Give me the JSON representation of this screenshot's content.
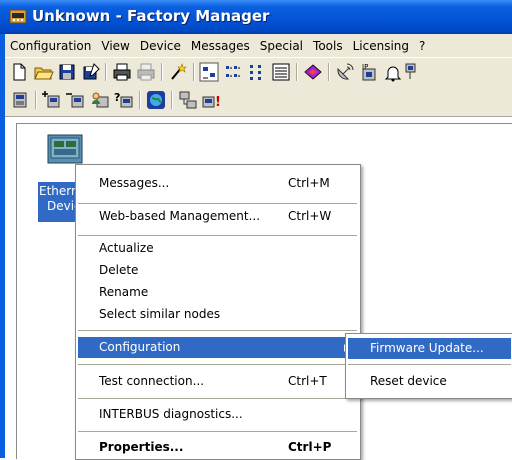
{
  "window": {
    "title": "Unknown - Factory Manager"
  },
  "menubar": [
    "Configuration",
    "View",
    "Device",
    "Messages",
    "Special",
    "Tools",
    "Licensing",
    "?"
  ],
  "toolbar1_icons": [
    "new-icon",
    "open-icon",
    "save-icon",
    "save-as-icon",
    "print-icon",
    "print-preview-icon",
    "wizard-icon",
    "large-icons-icon",
    "small-icons-icon",
    "list-icon",
    "details-icon",
    "book-icon",
    "satellite-icon",
    "ip-icon",
    "bell-icon",
    "network-icon"
  ],
  "toolbar2_icons": [
    "device-list-icon",
    "add-device-icon",
    "remove-device-icon",
    "person-icon",
    "help-device-icon",
    "globe-icon",
    "network-config-icon",
    "alert-device-icon"
  ],
  "node": {
    "label_line1": "Ethern",
    "label_line2": "Devic"
  },
  "context_menu": {
    "items": [
      {
        "label": "Messages...",
        "shortcut": "Ctrl+M"
      },
      {
        "label": "Web-based Management...",
        "shortcut": "Ctrl+W"
      },
      {
        "label": "Actualize"
      },
      {
        "label": "Delete"
      },
      {
        "label": "Rename"
      },
      {
        "label": "Select similar nodes"
      },
      {
        "label": "Configuration",
        "highlighted": true
      },
      {
        "label": "Test connection...",
        "shortcut": "Ctrl+T"
      },
      {
        "label": "INTERBUS diagnostics..."
      },
      {
        "label": "Properties...",
        "shortcut": "Ctrl+P",
        "bold": true
      }
    ]
  },
  "submenu": {
    "items": [
      {
        "label": "Firmware Update...",
        "highlighted": true
      },
      {
        "label": "Reset device"
      }
    ]
  },
  "colors": {
    "highlight": "#316ac5",
    "titlebar": "#0454d7",
    "menubar": "#ece9d8"
  }
}
